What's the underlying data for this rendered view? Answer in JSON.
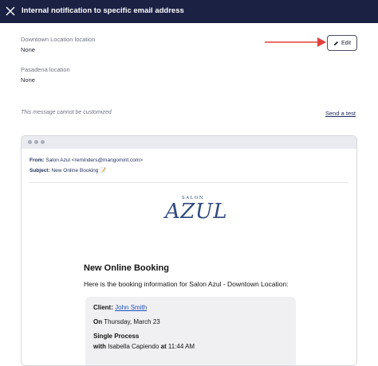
{
  "header": {
    "title": "Internal notification to specific email address",
    "close_icon": "close-icon"
  },
  "locations": [
    {
      "label": "Downtown Location location",
      "value": "None"
    },
    {
      "label": "Pasadena location",
      "value": "None"
    }
  ],
  "edit_button": {
    "label": "Edit",
    "icon": "pencil-icon"
  },
  "annotation_arrow_color": "#e2403a",
  "info_text": "This message cannot be customized",
  "send_test_label": "Send a test",
  "preview": {
    "from_label": "From:",
    "from_value": "Salon Azul <reminders@mangomint.com>",
    "subject_label": "Subject:",
    "subject_value": "New Online Booking 📝",
    "logo_small": "SALON",
    "logo_big": "AZUL",
    "heading": "New Online Booking",
    "intro": "Here is the booking information for Salon Azul - Downtown Location:",
    "client_label": "Client:",
    "client_name": "John Smith",
    "on_label": "On",
    "date": "Thursday, March 23",
    "service": "Single Process",
    "with_label": "with",
    "staff": "Isabella Capiendo",
    "at_label": "at",
    "time": "11:44 AM"
  },
  "colors": {
    "header_bg": "#1b2143",
    "link": "#1f4fbf",
    "brand": "#2f4a7d"
  }
}
